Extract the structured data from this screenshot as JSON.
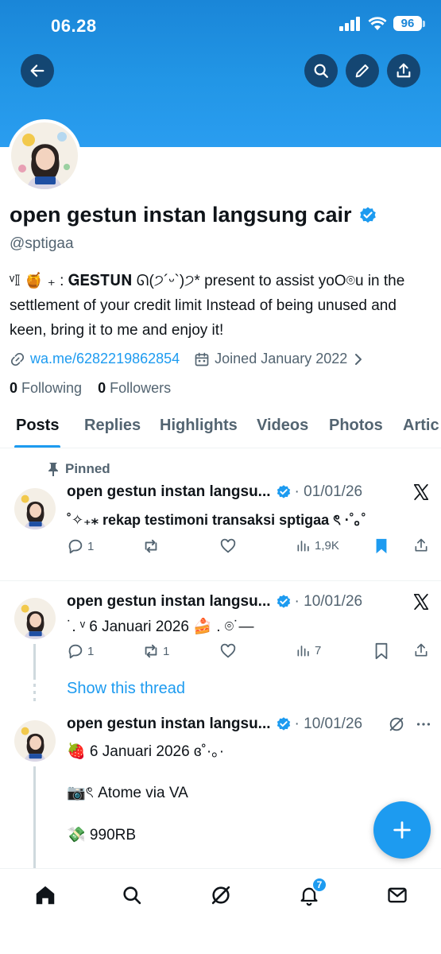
{
  "status_bar": {
    "time": "06.28",
    "battery": "96"
  },
  "colors": {
    "accent": "#1d9bf0",
    "banner": "#1a86d8",
    "text": "#0f1419",
    "muted": "#536471"
  },
  "header_actions": [
    "back-arrow-icon",
    "search-icon",
    "pencil-icon",
    "share-icon"
  ],
  "profile": {
    "display_name": "open gestun instan langsung cair",
    "handle": "@sptigaa",
    "bio": "ᵛ𝕀 🍯 ₊ : 𝐆𝐄𝐒𝐓𝐔𝐍 ᘏ(੭´ᵕ`)੭* present to assist yoO⌾u in the settlement of your credit limit Instead of being unused and keen, bring it to me and enjoy it!",
    "link": "wa.me/6282219862854",
    "joined": "Joined January 2022",
    "following_count": "0",
    "following_label": "Following",
    "followers_count": "0",
    "followers_label": "Followers"
  },
  "tabs": [
    "Posts",
    "Replies",
    "Highlights",
    "Videos",
    "Photos",
    "Artic"
  ],
  "pinned_label": "Pinned",
  "posts": [
    {
      "name": "open gestun instan langsu...",
      "date": "· 01/01/26",
      "text": "˚✧₊⁎ rekap testimoni transaksi sptigaa ৎ ·˚｡˚",
      "replies": "1",
      "reposts": "",
      "views": "1,9K"
    },
    {
      "name": "open gestun instan langsu...",
      "date": "· 10/01/26",
      "text": "˙. ᵛ 6 Januari 2026 🍰 . ⌾˙—",
      "replies": "1",
      "reposts": "1",
      "views": "7"
    },
    {
      "name": "open gestun instan langsu...",
      "date": "· 10/01/26",
      "lines": [
        "🍓 6 Januari 2026 ɞ˚·｡·",
        "📷ৎ Atome via VA",
        "💸 990RB"
      ]
    }
  ],
  "show_thread": "Show this thread",
  "nav": {
    "notifications_badge": "7"
  }
}
